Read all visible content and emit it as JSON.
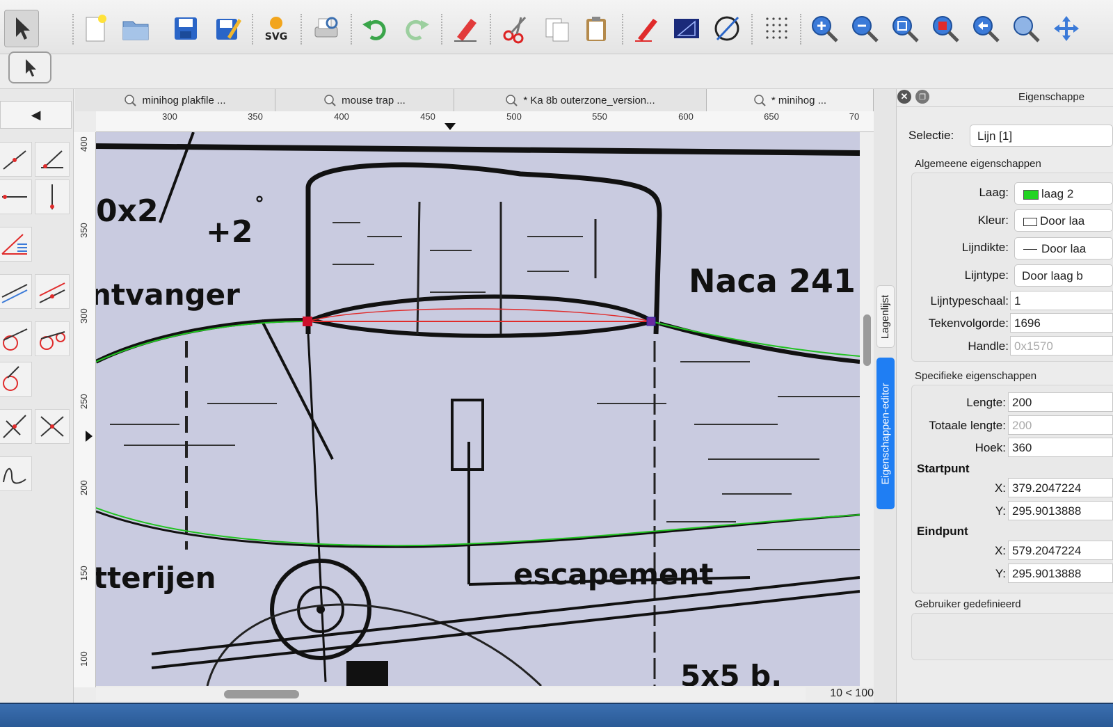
{
  "tabs": [
    {
      "label": "minihog plakfile ..."
    },
    {
      "label": "mouse trap ..."
    },
    {
      "label": "* Ka 8b outerzone_version..."
    },
    {
      "label": "* minihog ..."
    }
  ],
  "ruler": {
    "top_ticks": [
      "300",
      "350",
      "400",
      "450",
      "500",
      "550",
      "600",
      "650",
      "70"
    ],
    "left_ticks": [
      "400",
      "350",
      "300",
      "250",
      "200",
      "150",
      "100"
    ]
  },
  "status": {
    "text": "10 < 100"
  },
  "side_tabs": {
    "layers": "Lagenlijst",
    "editor": "Eigenschappen-editor"
  },
  "properties": {
    "title": "Eigenschappe",
    "selection_label": "Selectie:",
    "selection_value": "Lijn [1]",
    "general_title": "Algemeene eigenschappen",
    "layer_label": "Laag:",
    "layer_value": "laag 2",
    "layer_color": "#22d422",
    "color_label": "Kleur:",
    "color_value": "Door laa",
    "linewidth_label": "Lijndikte:",
    "linewidth_value": "Door laa",
    "linetype_label": "Lijntype:",
    "linetype_value": "Door laag b",
    "linetypescale_label": "Lijntypeschaal:",
    "linetypescale_value": "1",
    "draworder_label": "Tekenvolgorde:",
    "draworder_value": "1696",
    "handle_label": "Handle:",
    "handle_value": "0x1570",
    "specific_title": "Specifieke eigenschappen",
    "length_label": "Lengte:",
    "length_value": "200",
    "totallength_label": "Totaale lengte:",
    "totallength_value": "200",
    "angle_label": "Hoek:",
    "angle_value": "360",
    "startpoint_label": "Startpunt",
    "start_x_label": "X:",
    "start_x_value": "379.2047224",
    "start_y_label": "Y:",
    "start_y_value": "295.9013888",
    "endpoint_label": "Eindpunt",
    "end_x_label": "X:",
    "end_x_value": "579.2047224",
    "end_y_label": "Y:",
    "end_y_value": "295.9013888",
    "user_defined_title": "Gebruiker gedefinieerd"
  },
  "drawing": {
    "labels": {
      "naca": "Naca 241",
      "vanger": "ntvanger",
      "escapement": "escapement",
      "batterijen": "tterijen",
      "plus2": "+2",
      "x2": "0x2",
      "bottom": "5x5 b."
    }
  }
}
